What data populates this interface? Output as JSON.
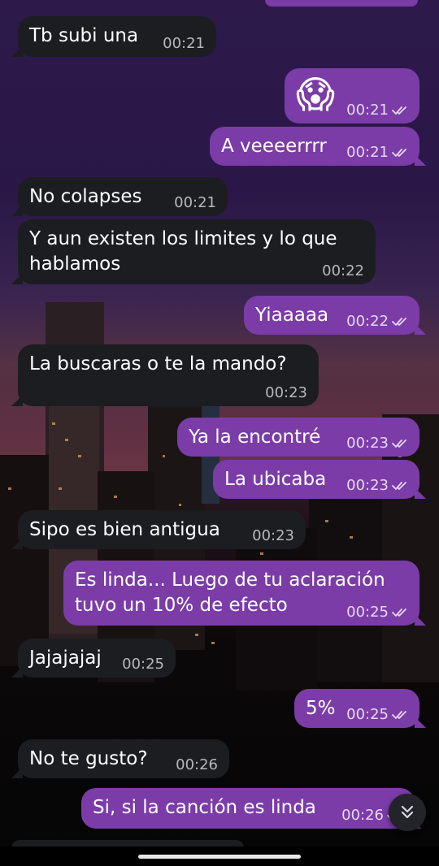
{
  "colors": {
    "incoming_bubble": "#1c1d21",
    "outgoing_bubble": "#7b3ca8",
    "wallpaper_top": "#2d1a4a",
    "wallpaper_bottom": "#050505"
  },
  "messages": [
    {
      "direction": "in",
      "text": "Tb subi una",
      "time": "00:21"
    },
    {
      "direction": "out",
      "emoji": "😱",
      "time": "00:21",
      "status": "read"
    },
    {
      "direction": "out",
      "text": "A veeeerrrr",
      "time": "00:21",
      "status": "read"
    },
    {
      "direction": "in",
      "text": "No colapses",
      "time": "00:21"
    },
    {
      "direction": "in",
      "text": "Y aun existen los limites y lo que hablamos",
      "time": "00:22"
    },
    {
      "direction": "out",
      "text": "Yiaaaaa",
      "time": "00:22",
      "status": "read"
    },
    {
      "direction": "in",
      "text": "La buscaras o te la mando?",
      "time": "00:23"
    },
    {
      "direction": "out",
      "text": "Ya la encontré",
      "time": "00:23",
      "status": "read"
    },
    {
      "direction": "out",
      "text": "La ubicaba",
      "time": "00:23",
      "status": "read"
    },
    {
      "direction": "in",
      "text": "Sipo es bien antigua",
      "time": "00:23"
    },
    {
      "direction": "out",
      "text": "Es linda... Luego de tu aclaración tuvo un 10% de efecto",
      "time": "00:25",
      "status": "read"
    },
    {
      "direction": "in",
      "text": "Jajajajaj",
      "time": "00:25"
    },
    {
      "direction": "out",
      "text": "5%",
      "time": "00:25",
      "status": "read"
    },
    {
      "direction": "in",
      "text": "No te gusto?",
      "time": "00:26"
    },
    {
      "direction": "out",
      "text": "Si, si la canción es linda",
      "time": "00:26",
      "status": "read"
    }
  ],
  "icons": {
    "read_receipt": "double-check-icon",
    "scroll_down": "chevron-double-down-icon"
  }
}
